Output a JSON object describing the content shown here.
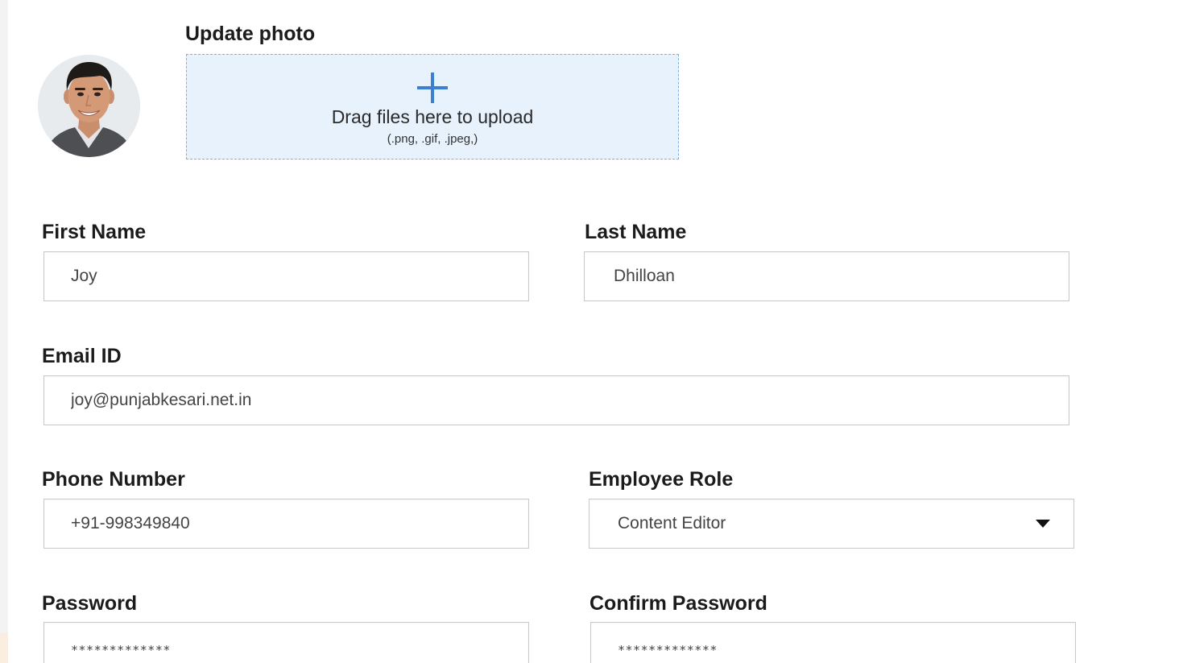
{
  "photo": {
    "heading": "Update photo",
    "dropzone_text": "Drag files here to upload",
    "dropzone_hint": "(.png, .gif, .jpeg,)",
    "upload_icon": "plus-icon"
  },
  "form": {
    "first_name": {
      "label": "First Name",
      "value": "Joy"
    },
    "last_name": {
      "label": "Last Name",
      "value": "Dhilloan"
    },
    "email": {
      "label": "Email ID",
      "value": "joy@punjabkesari.net.in"
    },
    "phone": {
      "label": "Phone Number",
      "value": "+91-998349840"
    },
    "role": {
      "label": "Employee Role",
      "value": "Content Editor",
      "icon": "dropdown-caret-icon"
    },
    "password": {
      "label": "Password",
      "value": "*************"
    },
    "confirm_password": {
      "label": "Confirm Password",
      "value": "*************"
    }
  },
  "colors": {
    "accent": "#3b7fd0",
    "dropzone_bg": "#e7f2fd",
    "dropzone_border": "#7fb0d9",
    "field_border": "#c9c9c9",
    "label": "#1b1b1b"
  }
}
